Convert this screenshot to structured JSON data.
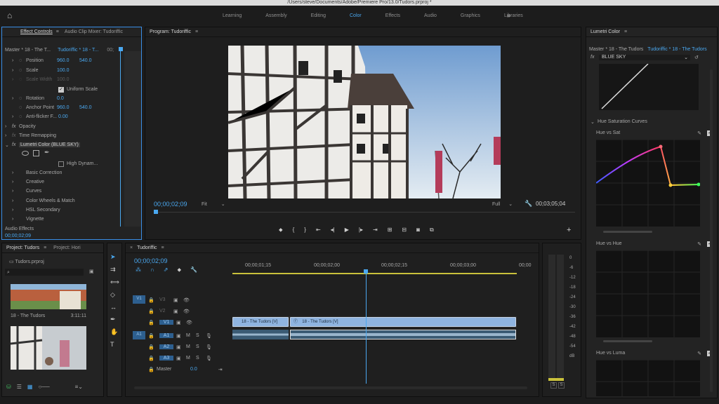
{
  "title_bar": "/Users/steve/Documents/Adobe/Premiere Pro/13.0/Tudors.prproj *",
  "workspaces": {
    "home_icon": "home-icon",
    "items": [
      "Learning",
      "Assembly",
      "Editing",
      "Color",
      "Effects",
      "Audio",
      "Graphics",
      "Libraries"
    ],
    "active": "Color",
    "more": "»"
  },
  "effect_controls": {
    "tab": "Effect Controls",
    "tab2": "Audio Clip Mixer: Tudoriffic",
    "master": "Master * 18 - The T...",
    "sequence": "Tudoriffic * 18 - T...",
    "time_marker": "00;",
    "position": {
      "label": "Position",
      "x": "960.0",
      "y": "540.0"
    },
    "scale": {
      "label": "Scale",
      "value": "100.0"
    },
    "scale_width": {
      "label": "Scale Width",
      "value": "100.0"
    },
    "uniform": "Uniform Scale",
    "rotation": {
      "label": "Rotation",
      "value": "0.0"
    },
    "anchor": {
      "label": "Anchor Point",
      "x": "960.0",
      "y": "540.0"
    },
    "antiflicker": {
      "label": "Anti-flicker F...",
      "value": "0.00"
    },
    "opacity": "Opacity",
    "time_remap": "Time Remapping",
    "lumetri": "Lumetri Color (BLUE SKY)",
    "high_dynamic": "High Dynam...",
    "sections": [
      "Basic Correction",
      "Creative",
      "Curves",
      "Color Wheels & Match",
      "HSL Secondary",
      "Vignette"
    ],
    "audio_effects": "Audio Effects",
    "timecode": "00;00;02;09"
  },
  "program": {
    "tab": "Program: Tudoriffic",
    "timecode": "00;00;02;09",
    "fit": "Fit",
    "full": "Full",
    "duration": "00;03;05;04"
  },
  "project": {
    "tab": "Project: Tudors",
    "tab2": "Project: Hori",
    "file": "Tudors.prproj",
    "items": [
      {
        "name": "18 - The Tudors",
        "duration": "3:11:11"
      }
    ]
  },
  "timeline": {
    "tab": "Tudoriffic",
    "timecode": "00;00;02;09",
    "ruler": [
      "00;00;01;15",
      "00;00;02;00",
      "00;00;02;15",
      "00;00;03;00",
      "00;00"
    ],
    "video_tracks": [
      "V3",
      "V2",
      "V1"
    ],
    "audio_tracks": [
      "A1",
      "A2",
      "A3"
    ],
    "src_v": "V1",
    "src_a": "A1",
    "clip1": "18 - The Tudors [V]",
    "clip2": "18 - The Tudors [V]",
    "master": "Master",
    "master_val": "0.0"
  },
  "meter": {
    "labels": [
      "0",
      "-6",
      "-12",
      "-18",
      "-24",
      "-30",
      "-36",
      "-42",
      "-48",
      "-54",
      "dB"
    ],
    "solo": [
      "S",
      "S"
    ]
  },
  "lumetri": {
    "tab": "Lumetri Color",
    "master": "Master * 18 - The Tudors",
    "sequence": "Tudoriffic * 18 - The Tudors",
    "preset": "BLUE SKY",
    "hsc": "Hue Saturation Curves",
    "hue_sat": "Hue vs Sat",
    "hue_hue": "Hue vs Hue",
    "hue_luma": "Hue vs Luma"
  }
}
